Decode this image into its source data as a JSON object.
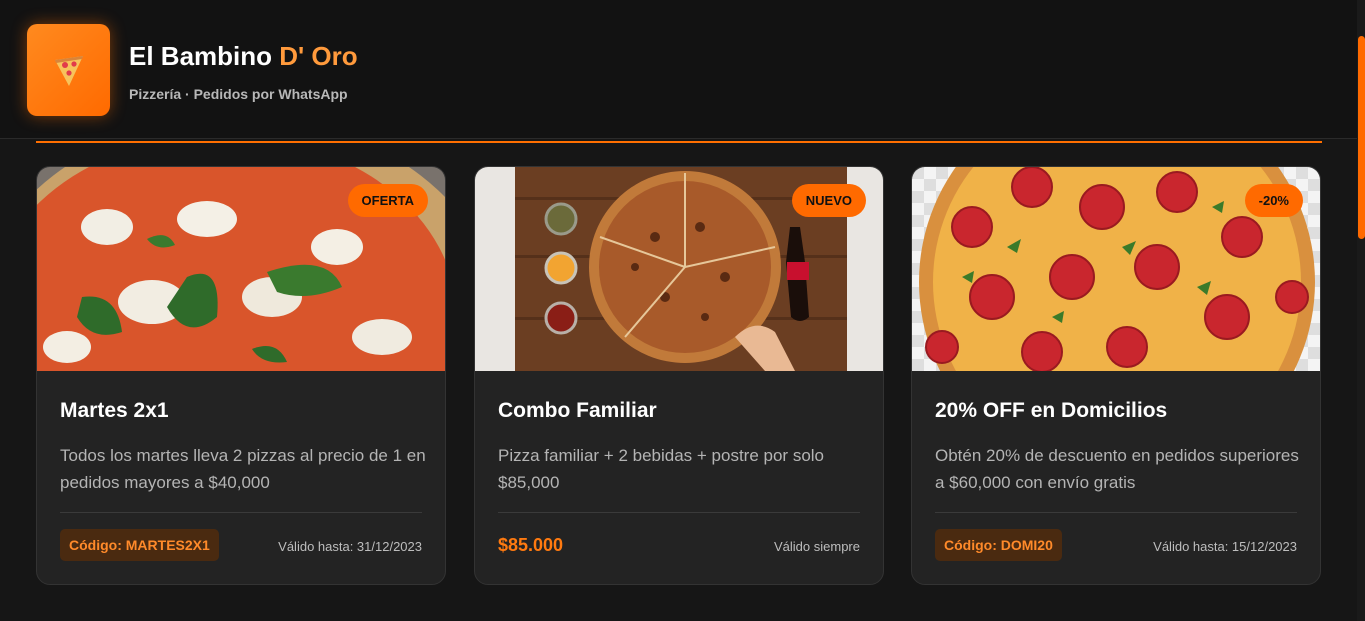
{
  "header": {
    "logo_icon": "pizza-slice-icon",
    "title_main": "El Bambino",
    "title_accent": "D' Oro",
    "subtitle": "Pizzería · Pedidos por WhatsApp"
  },
  "colors": {
    "accent": "#ff6a00",
    "background": "#161616",
    "card": "#232323"
  },
  "promos": [
    {
      "badge": "OFERTA",
      "title": "Martes 2x1",
      "description": "Todos los martes lleva 2 pizzas al precio de 1 en pedidos mayores a $40,000",
      "code": "Código: MARTES2X1",
      "valid": "Válido hasta: 31/12/2023",
      "image": "margherita-pizza"
    },
    {
      "badge": "NUEVO",
      "title": "Combo Familiar",
      "description": "Pizza familiar + 2 bebidas + postre por solo $85,000",
      "price": "$85.000",
      "valid": "Válido siempre",
      "image": "family-pizza-with-sauces-and-cola"
    },
    {
      "badge": "-20%",
      "title": "20% OFF en Domicilios",
      "description": "Obtén 20% de descuento en pedidos superiores a $60,000 con envío gratis",
      "code": "Código: DOMI20",
      "valid": "Válido hasta: 15/12/2023",
      "image": "pepperoni-pizza"
    }
  ]
}
